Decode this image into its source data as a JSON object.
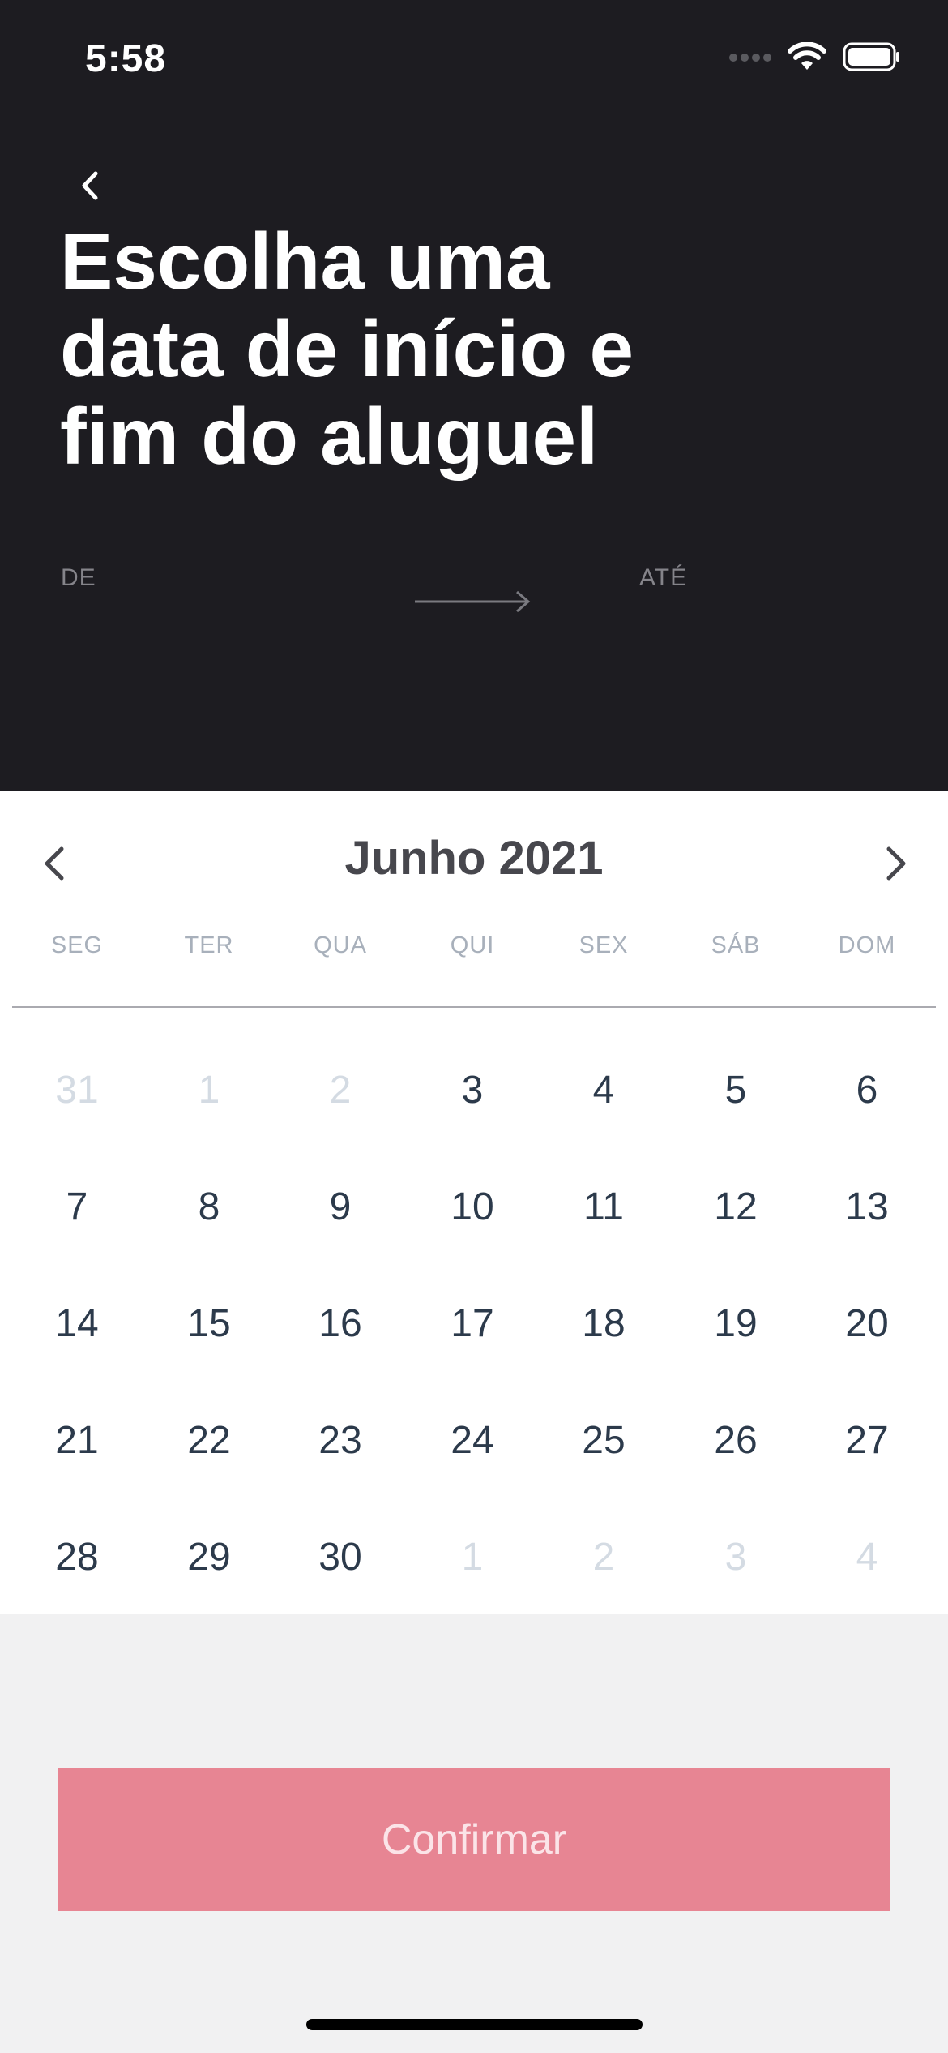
{
  "status_bar": {
    "time": "5:58"
  },
  "header": {
    "title": "Escolha uma data de início e fim do aluguel",
    "from_label": "DE",
    "to_label": "ATÉ"
  },
  "calendar": {
    "month_label": "Junho 2021",
    "weekdays": [
      "SEG",
      "TER",
      "QUA",
      "QUI",
      "SEX",
      "SÁB",
      "DOM"
    ],
    "weeks": [
      [
        {
          "d": "31",
          "m": true
        },
        {
          "d": "1",
          "m": true
        },
        {
          "d": "2",
          "m": true
        },
        {
          "d": "3",
          "m": false
        },
        {
          "d": "4",
          "m": false
        },
        {
          "d": "5",
          "m": false
        },
        {
          "d": "6",
          "m": false
        }
      ],
      [
        {
          "d": "7",
          "m": false
        },
        {
          "d": "8",
          "m": false
        },
        {
          "d": "9",
          "m": false
        },
        {
          "d": "10",
          "m": false
        },
        {
          "d": "11",
          "m": false
        },
        {
          "d": "12",
          "m": false
        },
        {
          "d": "13",
          "m": false
        }
      ],
      [
        {
          "d": "14",
          "m": false
        },
        {
          "d": "15",
          "m": false
        },
        {
          "d": "16",
          "m": false
        },
        {
          "d": "17",
          "m": false
        },
        {
          "d": "18",
          "m": false
        },
        {
          "d": "19",
          "m": false
        },
        {
          "d": "20",
          "m": false
        }
      ],
      [
        {
          "d": "21",
          "m": false
        },
        {
          "d": "22",
          "m": false
        },
        {
          "d": "23",
          "m": false
        },
        {
          "d": "24",
          "m": false
        },
        {
          "d": "25",
          "m": false
        },
        {
          "d": "26",
          "m": false
        },
        {
          "d": "27",
          "m": false
        }
      ],
      [
        {
          "d": "28",
          "m": false
        },
        {
          "d": "29",
          "m": false
        },
        {
          "d": "30",
          "m": false
        },
        {
          "d": "1",
          "m": true
        },
        {
          "d": "2",
          "m": true
        },
        {
          "d": "3",
          "m": true
        },
        {
          "d": "4",
          "m": true
        }
      ]
    ]
  },
  "footer": {
    "confirm_label": "Confirmar"
  },
  "icons": {
    "back": "chevron-left-icon",
    "prev_month": "chevron-left-icon",
    "next_month": "chevron-right-icon",
    "range": "arrow-right-icon"
  },
  "colors": {
    "header_bg": "#1d1c21",
    "accent": "#e78593",
    "day_text": "#2c3a4b",
    "muted_day_text": "#d4dbe3"
  }
}
